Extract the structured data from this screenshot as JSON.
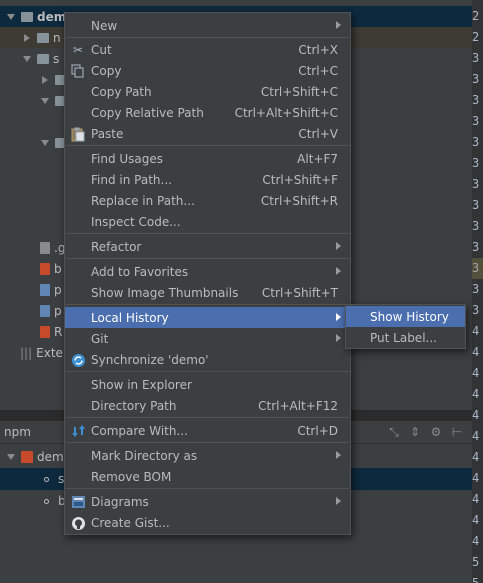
{
  "project_tree": {
    "root_label": "dem",
    "items": [
      {
        "label": "n",
        "type": "folder",
        "arrow": "right"
      },
      {
        "label": "s",
        "type": "folder",
        "arrow": "down"
      }
    ],
    "file_labels": [
      ".g",
      "b",
      "p",
      "p",
      "R"
    ],
    "external_label": "Exter"
  },
  "gutter": {
    "line_numbers": [
      "2",
      "2",
      "3",
      "3",
      "3",
      "3",
      "3",
      "3",
      "3",
      "3",
      "3",
      "3",
      "3",
      "3",
      "3",
      "4",
      "4",
      "4",
      "4",
      "4",
      "4",
      "4",
      "4",
      "4",
      "4",
      "4",
      "5",
      "5"
    ]
  },
  "bottom_panel": {
    "title": "npm",
    "root_label": "dem",
    "items": [
      "s",
      "b"
    ]
  },
  "context_menu": {
    "items": [
      {
        "label": "New",
        "icon": "",
        "submenu": true
      },
      {
        "label": "Cut",
        "shortcut": "Ctrl+X",
        "icon": "scissors-icon"
      },
      {
        "label": "Copy",
        "shortcut": "Ctrl+C",
        "icon": "copy-icon"
      },
      {
        "label": "Copy Path",
        "shortcut": "Ctrl+Shift+C"
      },
      {
        "label": "Copy Relative Path",
        "shortcut": "Ctrl+Alt+Shift+C"
      },
      {
        "label": "Paste",
        "shortcut": "Ctrl+V",
        "icon": "paste-icon"
      },
      {
        "label": "Find Usages",
        "shortcut": "Alt+F7"
      },
      {
        "label": "Find in Path...",
        "shortcut": "Ctrl+Shift+F"
      },
      {
        "label": "Replace in Path...",
        "shortcut": "Ctrl+Shift+R"
      },
      {
        "label": "Inspect Code..."
      },
      {
        "label": "Refactor",
        "submenu": true
      },
      {
        "label": "Add to Favorites",
        "submenu": true
      },
      {
        "label": "Show Image Thumbnails",
        "shortcut": "Ctrl+Shift+T"
      },
      {
        "label": "Local History",
        "submenu": true,
        "active": true
      },
      {
        "label": "Git",
        "submenu": true
      },
      {
        "label": "Synchronize 'demo'",
        "icon": "sync-icon"
      },
      {
        "label": "Show in Explorer"
      },
      {
        "label": "Directory Path",
        "shortcut": "Ctrl+Alt+F12"
      },
      {
        "label": "Compare With...",
        "shortcut": "Ctrl+D",
        "icon": "compare-icon"
      },
      {
        "label": "Mark Directory as",
        "submenu": true
      },
      {
        "label": "Remove BOM"
      },
      {
        "label": "Diagrams",
        "submenu": true,
        "icon": "diagram-icon"
      },
      {
        "label": "Create Gist...",
        "icon": "github-icon"
      }
    ]
  },
  "local_history_submenu": {
    "items": [
      {
        "label": "Show History",
        "active": true
      },
      {
        "label": "Put Label..."
      }
    ]
  },
  "colors": {
    "menu_bg": "#3c3f41",
    "menu_highlight": "#4b6eaf",
    "tree_selection": "#0d293e",
    "editor_bg": "#2b2b2b"
  }
}
